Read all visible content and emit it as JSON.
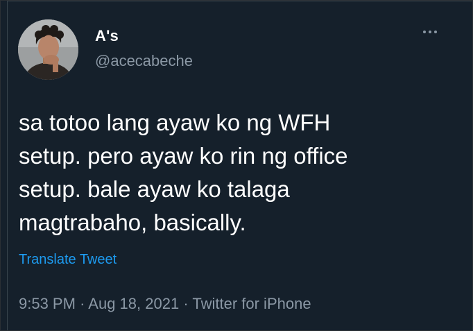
{
  "user": {
    "display_name": "A's",
    "handle": "@acecabeche"
  },
  "icons": {
    "more": "more-horizontal-icon"
  },
  "tweet": {
    "lines": [
      "sa totoo lang ayaw ko ng WFH",
      "setup. pero ayaw ko rin ng office",
      "setup. bale ayaw ko talaga",
      "magtrabaho, basically."
    ],
    "translate_label": "Translate Tweet",
    "time": "9:53 PM",
    "separator": "·",
    "date": "Aug 18, 2021",
    "source": "Twitter for iPhone"
  },
  "colors": {
    "background": "#15202b",
    "text": "#ffffff",
    "secondary_text": "#8b98a5",
    "link": "#1d9bf0"
  }
}
